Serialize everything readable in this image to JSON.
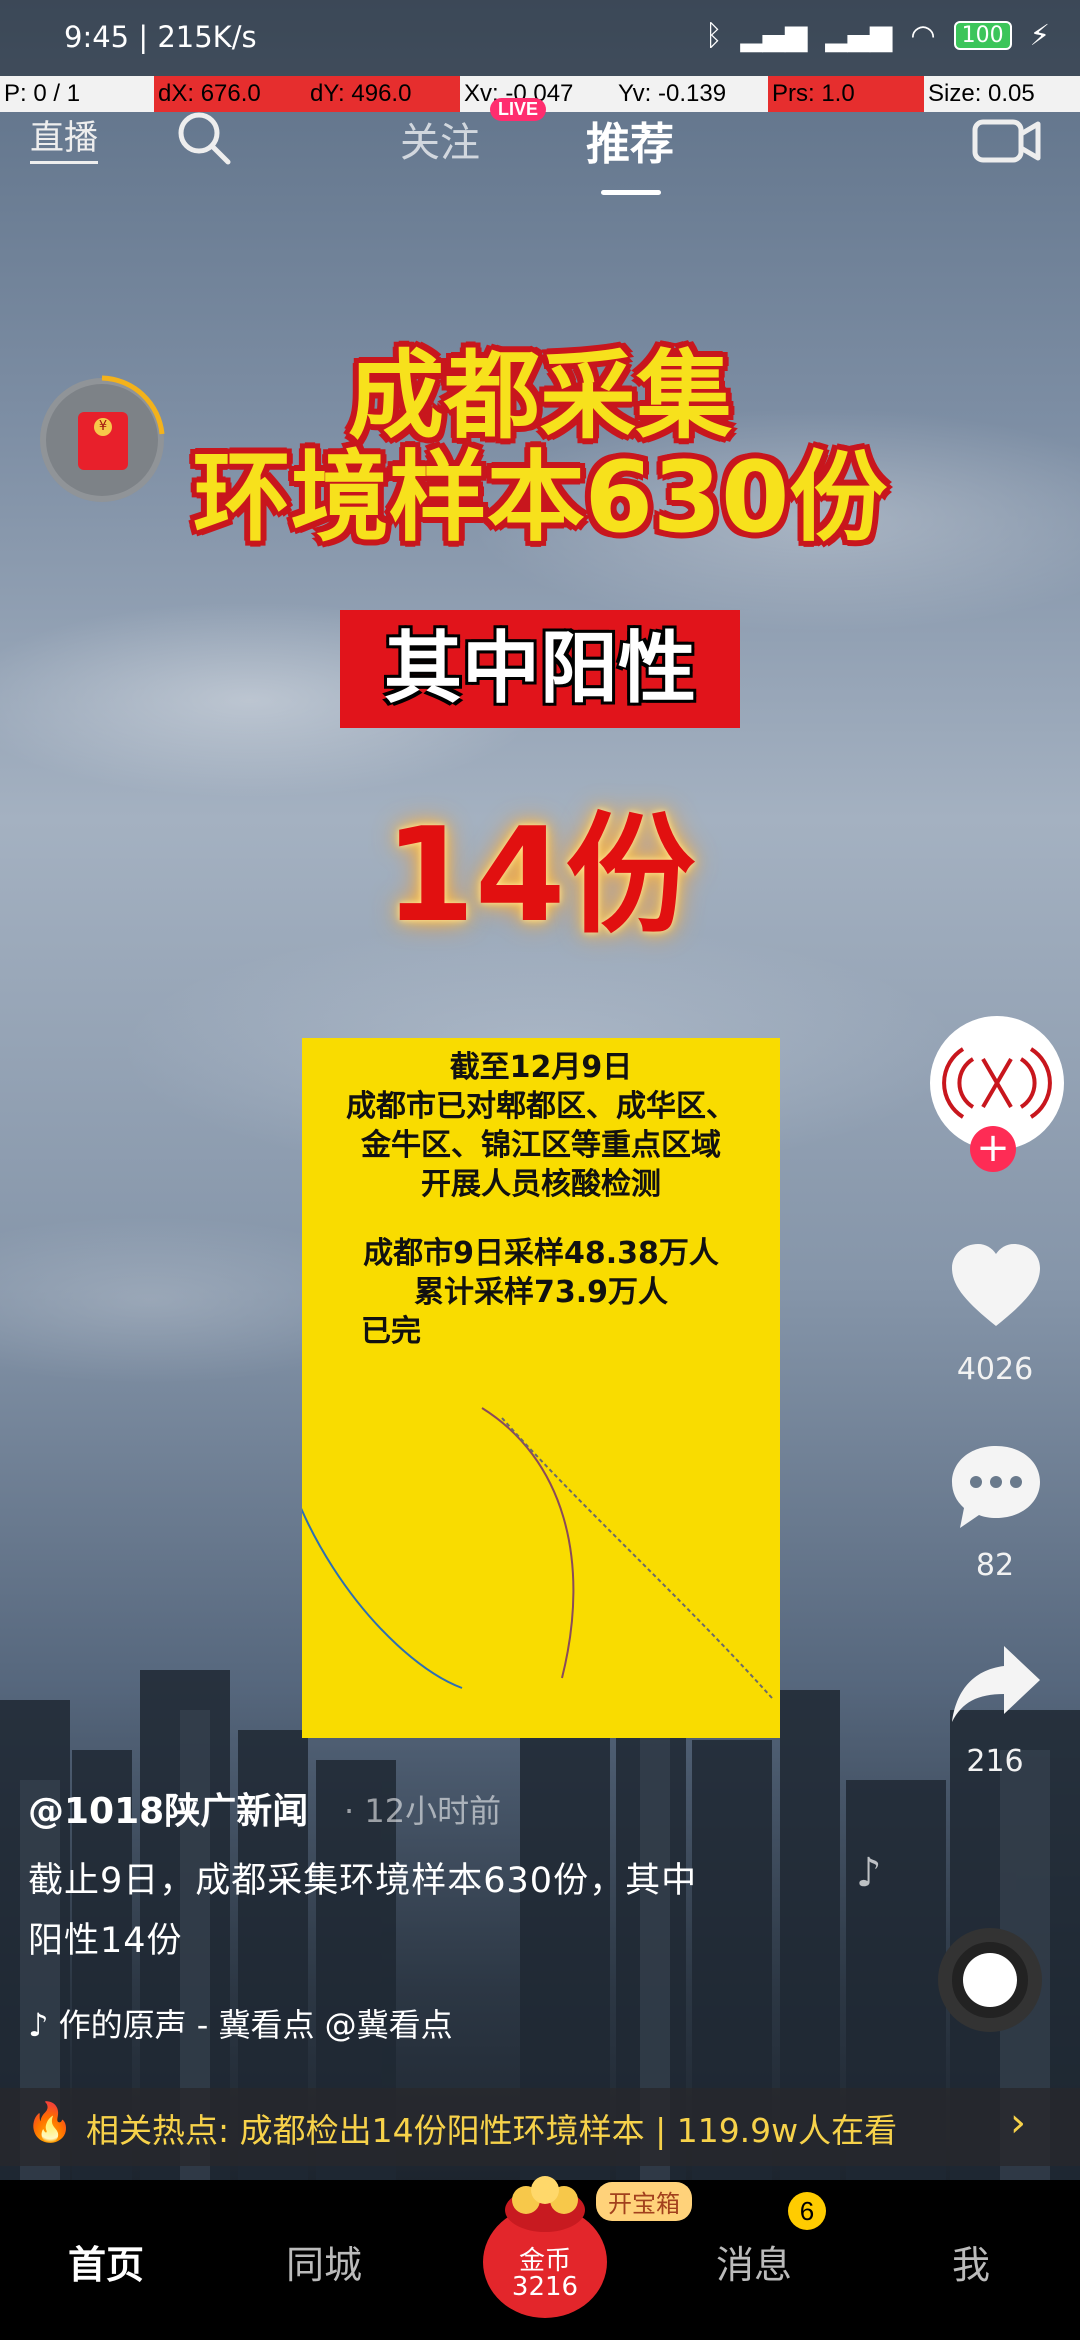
{
  "status_bar": {
    "time_speed": "9:45 | 215K/s",
    "battery": "100"
  },
  "debug_bar": {
    "p": "P: 0 / 1",
    "dx": "dX: 676.0",
    "dy": "dY: 496.0",
    "xv": "Xv: -0.047",
    "yv": "Yv: -0.139",
    "prs": "Prs: 1.0",
    "size": "Size: 0.05"
  },
  "top_nav": {
    "live": "直播",
    "follow": "关注",
    "live_badge": "LIVE",
    "recommend": "推荐"
  },
  "video": {
    "headline_line1": "成都采集",
    "headline_line2": "环境样本630份",
    "positive_label": "其中阳性",
    "positive_count": "14份",
    "card_lines": [
      "截至12月9日",
      "成都市已对郫都区、成华区、",
      "金牛区、锦江区等重点区域",
      "开展人员核酸检测",
      "成都市9日采样48.38万人",
      "累计采样73.9万人",
      "已完"
    ]
  },
  "right_rail": {
    "likes": "4026",
    "comments": "82",
    "shares": "216",
    "follow_plus": "+"
  },
  "post": {
    "author": "@1018陕广新闻",
    "time": "· 12小时前",
    "description_line1": "截止9日，成都采集环境样本630份，其中",
    "description_line2": "阳性14份",
    "music": "♪ 作的原声 - 冀看点    @冀看点"
  },
  "hot_topic": {
    "text": "相关热点: 成都检出14份阳性环境样本 | 119.9w人在看"
  },
  "tab_bar": {
    "home": "首页",
    "local": "同城",
    "coin_label": "金币",
    "coin_value": "3216",
    "treasure": "开宝箱",
    "messages": "消息",
    "messages_badge": "6",
    "me": "我"
  },
  "colors": {
    "headline": "#f7e11c",
    "headline_stroke": "#c8161d",
    "card_bg": "#f9dc00",
    "accent": "#fe2c55",
    "tab_bg": "#000000"
  }
}
